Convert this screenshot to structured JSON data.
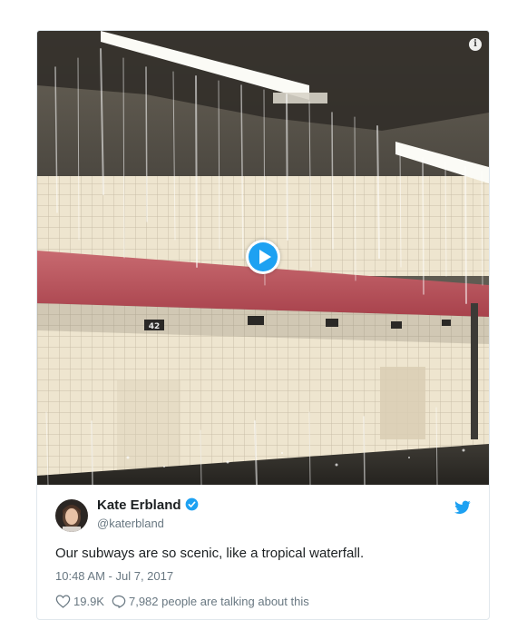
{
  "media": {
    "info_glyph": "i",
    "platform_sign_text": "42",
    "play_icon": "play-circle-icon"
  },
  "author": {
    "name": "Kate Erbland",
    "handle": "@katerbland",
    "verified": true
  },
  "tweet": {
    "text": "Our subways are so scenic, like a tropical waterfall.",
    "timestamp": "10:48 AM - Jul 7, 2017"
  },
  "actions": {
    "like_count": "19.9K",
    "conversation_text": "7,982 people are talking about this"
  },
  "colors": {
    "accent": "#1da1f2",
    "text_primary": "#1c2022",
    "text_secondary": "#697882",
    "card_border": "#e1e8ed",
    "tile": "#efe6d0",
    "red_stripe": "#b8505a"
  }
}
